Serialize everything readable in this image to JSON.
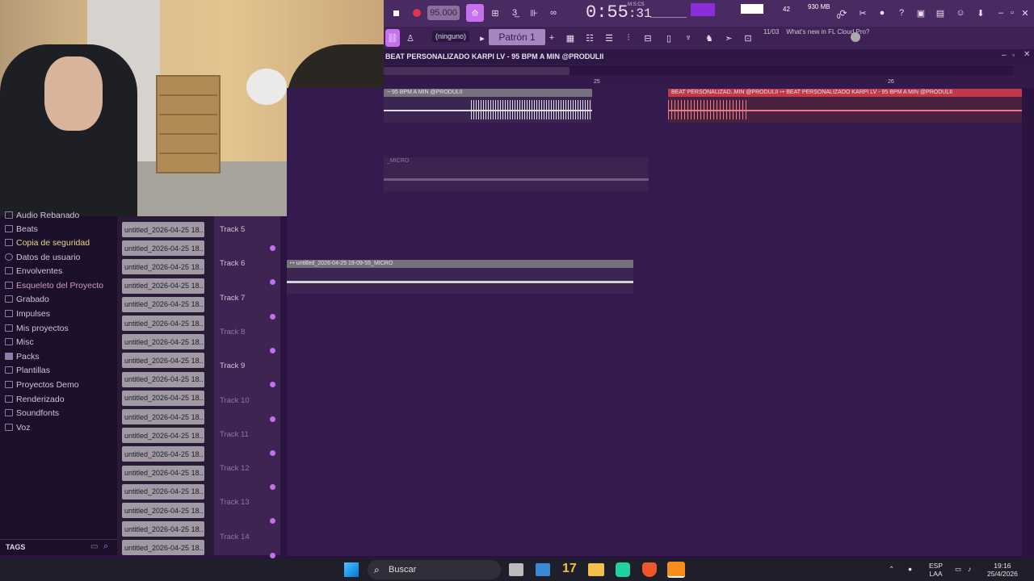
{
  "toolbar": {
    "tempo": "95.000",
    "time_main": "0:55",
    "time_sub": ":31",
    "time_unit": "M:S:CS",
    "cpu_value": "42",
    "memory": "930 MB",
    "memory_sub": "0",
    "pattern_label": "Patrón 1",
    "snap_label": "(ninguno)",
    "news_date": "11/03",
    "news_text": "What's new in FL Cloud Pro?"
  },
  "playlist": {
    "title": "BEAT PERSONALIZADO KARPI LV - 95 BPM A MIN @PRODULII",
    "ruler_marks": [
      "25",
      "26"
    ],
    "clips": {
      "clip1": "~ 95 BPM A MIN @PRODULII",
      "clip2": "BEAT PERSONALIZAD..MIN @PRODULII ↦ BEAT PERSONALIZADO KARPI LV - 95 BPM A MIN @PRODULII",
      "clip3": "_MICRO",
      "clip4": "↦ untitled_2026-04-25 19-09-55_MICRO"
    }
  },
  "sidebar": {
    "items": [
      {
        "label": "Audio Rebanado"
      },
      {
        "label": "Beats"
      },
      {
        "label": "Copia de seguridad"
      },
      {
        "label": "Datos de usuario"
      },
      {
        "label": "Envolventes"
      },
      {
        "label": "Esqueleto del Proyecto"
      },
      {
        "label": "Grabado"
      },
      {
        "label": "Impulses"
      },
      {
        "label": "Mis proyectos"
      },
      {
        "label": "Misc"
      },
      {
        "label": "Packs"
      },
      {
        "label": "Plantillas"
      },
      {
        "label": "Proyectos Demo"
      },
      {
        "label": "Renderizado"
      },
      {
        "label": "Soundfonts"
      },
      {
        "label": "Voz"
      }
    ],
    "tags_label": "TAGS"
  },
  "files": {
    "name": "untitled_2026-04-25 18..",
    "count_rows": 18
  },
  "tracks": [
    {
      "label": "Track 5"
    },
    {
      "label": "Track 6"
    },
    {
      "label": "Track 7"
    },
    {
      "label": "Track 8"
    },
    {
      "label": "Track 9"
    },
    {
      "label": "Track 10"
    },
    {
      "label": "Track 11"
    },
    {
      "label": "Track 12"
    },
    {
      "label": "Track 13"
    },
    {
      "label": "Track 14"
    }
  ],
  "taskbar": {
    "search_label": "Buscar",
    "lang_top": "ESP",
    "lang_bottom": "LAA",
    "clock_time": "19:16",
    "clock_date": "25/4/2026"
  },
  "colors": {
    "accent": "#c56ef0",
    "background": "#2b1340",
    "clip_red": "#c0394a",
    "clip_grey": "#6f6a73"
  }
}
